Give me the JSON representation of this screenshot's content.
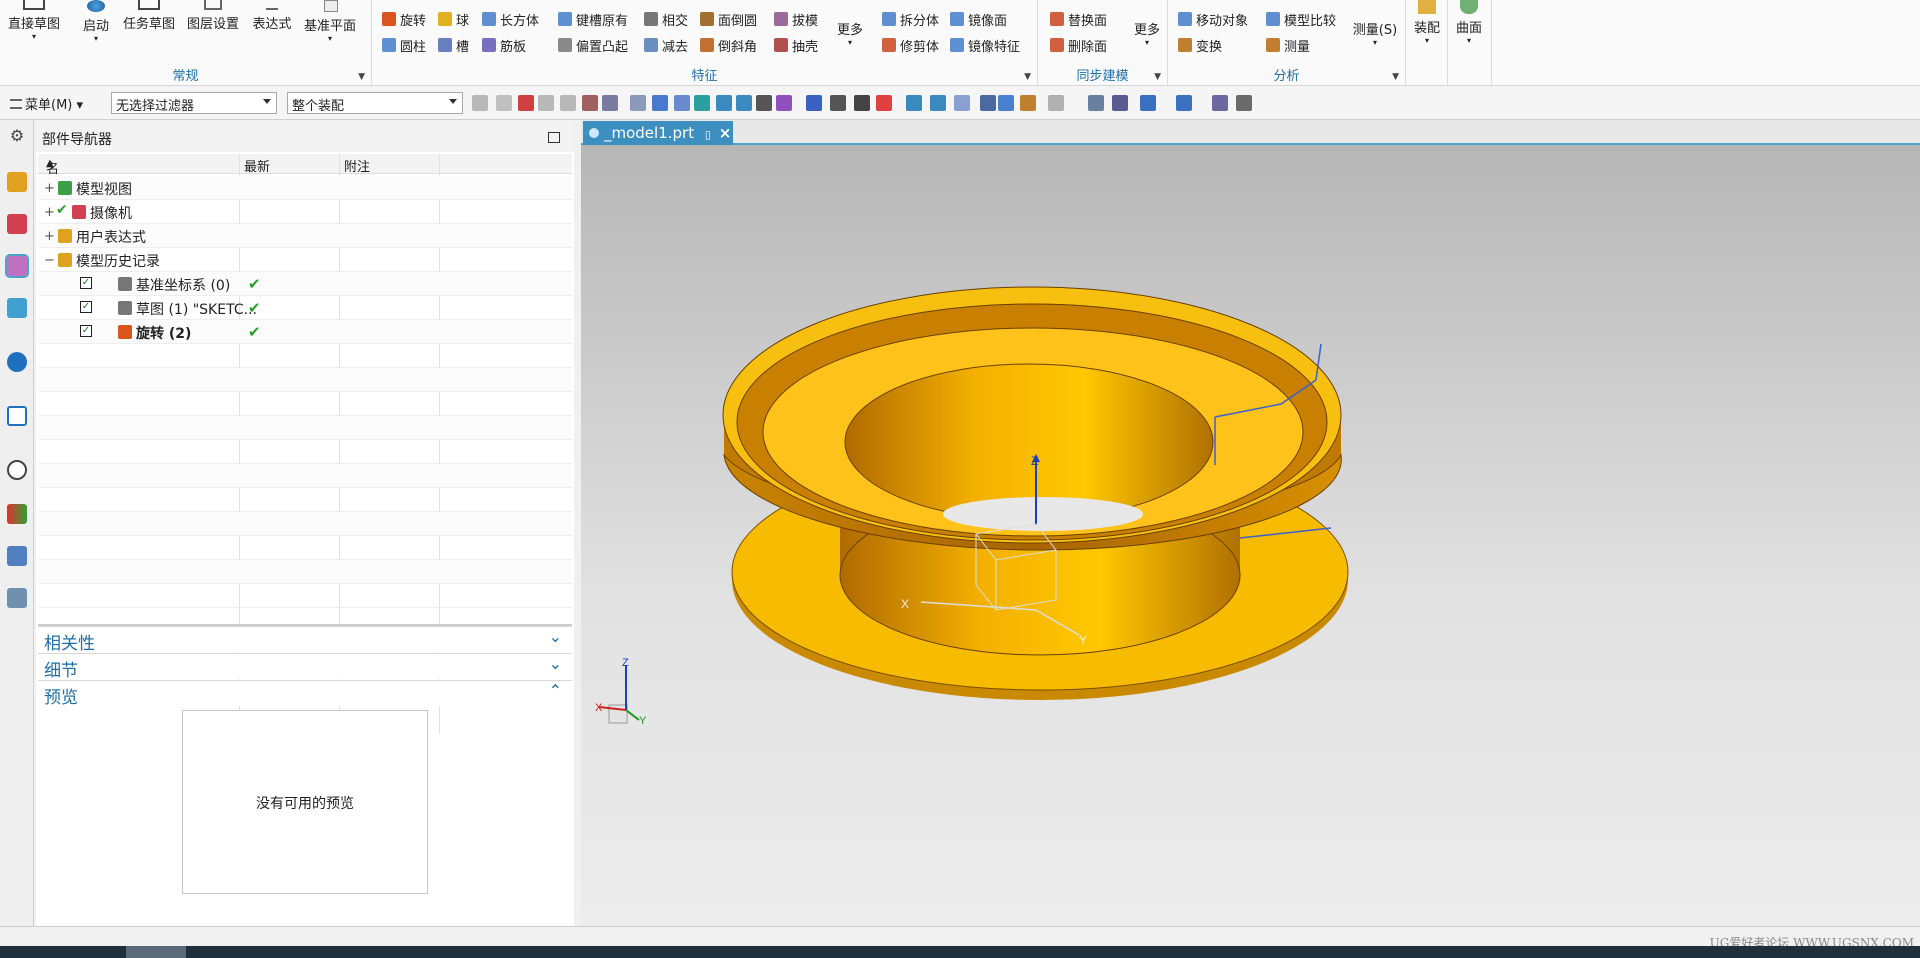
{
  "ribbon": {
    "big_buttons": [
      {
        "label": "直接草图",
        "dd": "▾"
      },
      {
        "label": "启动",
        "dd": "▾"
      },
      {
        "label": "任务草图",
        "dd": ""
      },
      {
        "label": "图层设置",
        "dd": ""
      },
      {
        "label": "表达式",
        "dd": ""
      },
      {
        "label": "基准平面",
        "dd": "▾"
      }
    ],
    "groups": {
      "normal": "常规",
      "feature": "特征",
      "sync": "同步建模",
      "analysis": "分析"
    },
    "feature_small": [
      {
        "label": "旋转",
        "color": "#d9541e"
      },
      {
        "label": "球",
        "color": "#e0b020"
      },
      {
        "label": "长方体",
        "color": "#5e8fd0"
      },
      {
        "label": "圆柱",
        "color": "#5e8fd0"
      },
      {
        "label": "槽",
        "color": "#6a7fbf"
      },
      {
        "label": "筋板",
        "color": "#7a6fbf"
      },
      {
        "label": "键槽原有",
        "color": "#5e8fd0"
      },
      {
        "label": "相交",
        "color": "#777777"
      },
      {
        "label": "面倒圆",
        "color": "#a07030"
      },
      {
        "label": "拔模",
        "color": "#9a6a9a"
      },
      {
        "label": "偏置凸起",
        "color": "#8a8a8a"
      },
      {
        "label": "减去",
        "color": "#6a8fbf"
      },
      {
        "label": "倒斜角",
        "color": "#c07030"
      },
      {
        "label": "抽壳",
        "color": "#b05050"
      },
      {
        "label": "拆分体",
        "color": "#5e8fd0"
      },
      {
        "label": "镜像面",
        "color": "#5e8fd0"
      },
      {
        "label": "修剪体",
        "color": "#d06040"
      },
      {
        "label": "镜像特征",
        "color": "#5e8fd0"
      }
    ],
    "more1": "更多",
    "sync_small": [
      {
        "label": "替换面",
        "color": "#d06040"
      },
      {
        "label": "删除面",
        "color": "#d06040"
      }
    ],
    "more2": "更多",
    "analysis_small": [
      {
        "label": "移动对象",
        "color": "#5e8fd0"
      },
      {
        "label": "模型比较",
        "color": "#5e8fd0"
      },
      {
        "label": "变换",
        "color": "#c08030"
      },
      {
        "label": "测量",
        "color": "#c08030"
      }
    ],
    "measure_big": "测量(S)",
    "assembly": "装配",
    "surface": "曲面"
  },
  "toolbar": {
    "menu_label": "菜单(M)",
    "filter_value": "无选择过滤器",
    "scope_value": "整个装配"
  },
  "navigator": {
    "title": "部件导航器",
    "columns": [
      "名称",
      "最新",
      "附注"
    ],
    "rows": [
      {
        "expander": "+",
        "label": "模型视图",
        "latest": "",
        "icon_color": "#3aa048"
      },
      {
        "expander": "+",
        "label": "摄像机",
        "latest": "",
        "icon_color": "#d04050"
      },
      {
        "expander": "+",
        "label": "用户表达式",
        "latest": "",
        "icon_color": "#e0a020"
      },
      {
        "expander": "−",
        "label": "模型历史记录",
        "latest": "",
        "icon_color": "#e0a020"
      },
      {
        "expander": "",
        "label": "基准坐标系 (0)",
        "latest": "✔",
        "icon_color": "#777777"
      },
      {
        "expander": "",
        "label": "草图 (1) \"SKETC...",
        "latest": "✔",
        "icon_color": "#777777"
      },
      {
        "expander": "",
        "label": "旋转 (2)",
        "latest": "✔",
        "icon_color": "#d9541e"
      }
    ],
    "sections": [
      {
        "label": "相关性",
        "chev": "⌄"
      },
      {
        "label": "细节",
        "chev": "⌄"
      },
      {
        "label": "预览",
        "chev": "⌃"
      }
    ],
    "preview_empty": "没有可用的预览"
  },
  "viewport": {
    "tab_label": "_model1.prt",
    "axis_x": "X",
    "axis_y": "Y",
    "axis_z": "Z"
  },
  "watermark": "UG爱好者论坛 WWW.UGSNX.COM",
  "colors": {
    "part": "#f5b800",
    "part_dark": "#b07000",
    "accent": "#1f6fa8"
  }
}
